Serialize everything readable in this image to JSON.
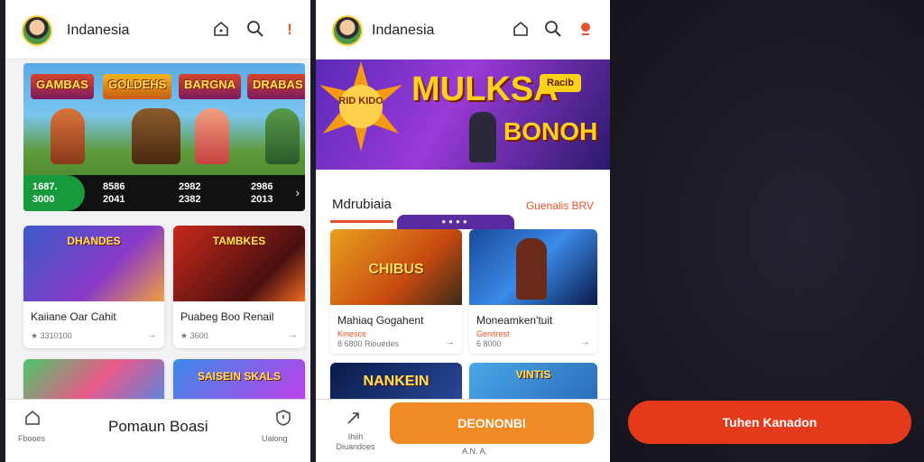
{
  "panel1": {
    "header": {
      "title": "Indanesia",
      "icons": [
        "home-icon",
        "search-icon",
        "alert-icon"
      ]
    },
    "banner": {
      "logos": [
        "GAMBAS",
        "GOLDEHS",
        "BARGNA",
        "DRABAS"
      ],
      "stats": [
        {
          "top": "1687.",
          "bottom": "3000"
        },
        {
          "top": "8586",
          "bottom": "2041"
        },
        {
          "top": "2982",
          "bottom": "2382"
        },
        {
          "top": "2986",
          "bottom": "2013"
        }
      ]
    },
    "cards": [
      {
        "thumb_text": "DHANDES",
        "title": "Kaiiane Oar Cahit",
        "meta": "★ 3310100"
      },
      {
        "thumb_text": "TAMBKES",
        "title": "Puabeg Boo Renail",
        "meta": "★ 3600"
      }
    ],
    "peek": [
      {
        "thumb_text": ""
      },
      {
        "thumb_text": "SAISEIN SKALS"
      }
    ],
    "bottom_nav": {
      "left_label": "Fbooes",
      "center_label": "Pomaun Boasi",
      "right_label": "Uaiong"
    }
  },
  "panel2": {
    "header": {
      "title": "Indanesia",
      "icons": [
        "home-icon",
        "search-icon",
        "pin-icon"
      ]
    },
    "banner": {
      "title": "MULKSA",
      "subtitle": "BONOH",
      "badge": "Racib",
      "burst": "RID KIDO"
    },
    "section": {
      "title": "Mdrubiaia",
      "see_all": "Guenalis BRV"
    },
    "cards": [
      {
        "thumb_text": "CHIBUS",
        "title": "Mahiaq Gogahent",
        "sub": "Kinesce",
        "meta": "8 6800 Riouedes"
      },
      {
        "thumb_text": "",
        "title": "Moneamken'tuit",
        "sub": "Genitrest",
        "meta": "6 8000"
      }
    ],
    "peek": [
      {
        "thumb_text": "NANKEIN"
      },
      {
        "thumb_text": "VINTIS"
      }
    ],
    "bottom_nav": {
      "left_label": "Ihiih Diuandoes",
      "cta": "DEONONBI",
      "center_label": "A.N. A."
    }
  },
  "panel3": {
    "cta": "Tuhen Kanadon"
  }
}
